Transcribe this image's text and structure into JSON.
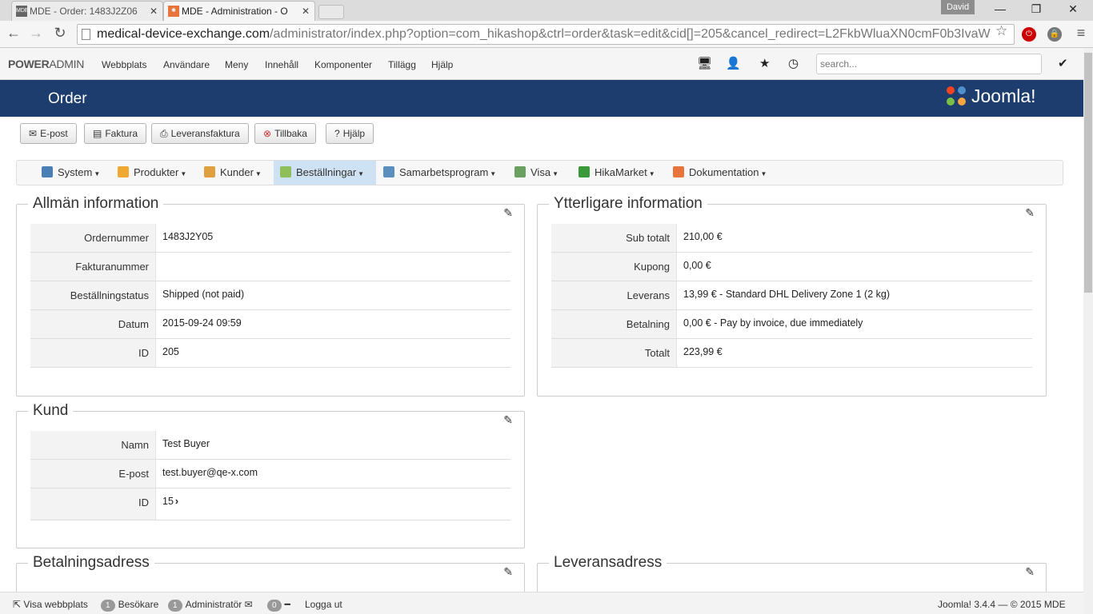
{
  "browser": {
    "tabs": [
      {
        "title": "MDE - Order: 1483J2Z06",
        "active": false
      },
      {
        "title": "MDE - Administration - O",
        "active": true
      }
    ],
    "profile": "David",
    "url_domain": "medical-device-exchange.com",
    "url_path": "/administrator/index.php?option=com_hikashop&ctrl=order&task=edit&cid[]=205&cancel_redirect=L2FkbWluaXN0cmF0b3IvaW"
  },
  "admin": {
    "brand_bold": "POWER",
    "brand_rest": "ADMIN",
    "menu": [
      "Webbplats",
      "Användare",
      "Meny",
      "Innehåll",
      "Komponenter",
      "Tillägg",
      "Hjälp"
    ],
    "search_placeholder": "search...",
    "page_title": "Order",
    "logo_text": "Joomla!"
  },
  "toolbar": {
    "email": "E-post",
    "invoice": "Faktura",
    "shipping_invoice": "Leveransfaktura",
    "back": "Tillbaka",
    "help": "Hjälp"
  },
  "hikamenu": [
    {
      "label": "System",
      "color": "#4a7fb5"
    },
    {
      "label": "Produkter",
      "color": "#f0a830"
    },
    {
      "label": "Kunder",
      "color": "#e0a040"
    },
    {
      "label": "Beställningar",
      "color": "#8fbf5a",
      "active": true
    },
    {
      "label": "Samarbetsprogram",
      "color": "#5a8fc0"
    },
    {
      "label": "Visa",
      "color": "#6aa060"
    },
    {
      "label": "HikaMarket",
      "color": "#3a9a3a"
    },
    {
      "label": "Dokumentation",
      "color": "#e8743b"
    }
  ],
  "general": {
    "legend": "Allmän information",
    "rows": [
      {
        "k": "Ordernummer",
        "v": "1483J2Y05"
      },
      {
        "k": "Fakturanummer",
        "v": ""
      },
      {
        "k": "Beställningstatus",
        "v": "Shipped (not paid)"
      },
      {
        "k": "Datum",
        "v": "2015-09-24 09:59"
      },
      {
        "k": "ID",
        "v": "205"
      }
    ]
  },
  "additional": {
    "legend": "Ytterligare information",
    "rows": [
      {
        "k": "Sub totalt",
        "v": "210,00 €"
      },
      {
        "k": "Kupong",
        "v": "0,00 €"
      },
      {
        "k": "Leverans",
        "v": "13,99 € - Standard DHL Delivery Zone 1 (2 kg)"
      },
      {
        "k": "Betalning",
        "v": "0,00 € - Pay by invoice, due immediately"
      },
      {
        "k": "Totalt",
        "v": "223,99 €"
      }
    ]
  },
  "customer": {
    "legend": "Kund",
    "rows": [
      {
        "k": "Namn",
        "v": "Test Buyer"
      },
      {
        "k": "E-post",
        "v": "test.buyer@qe-x.com"
      },
      {
        "k": "ID",
        "v": "15"
      }
    ]
  },
  "billing": {
    "legend": "Betalningsadress"
  },
  "shipping": {
    "legend": "Leveransadress"
  },
  "footer": {
    "view_site": "Visa webbplats",
    "visitors_count": "1",
    "visitors": "Besökare",
    "admins_count": "1",
    "admins": "Administratör",
    "messages_count": "0",
    "logout": "Logga ut",
    "version": "Joomla! 3.4.4",
    "copyright": "— © 2015 MDE"
  }
}
